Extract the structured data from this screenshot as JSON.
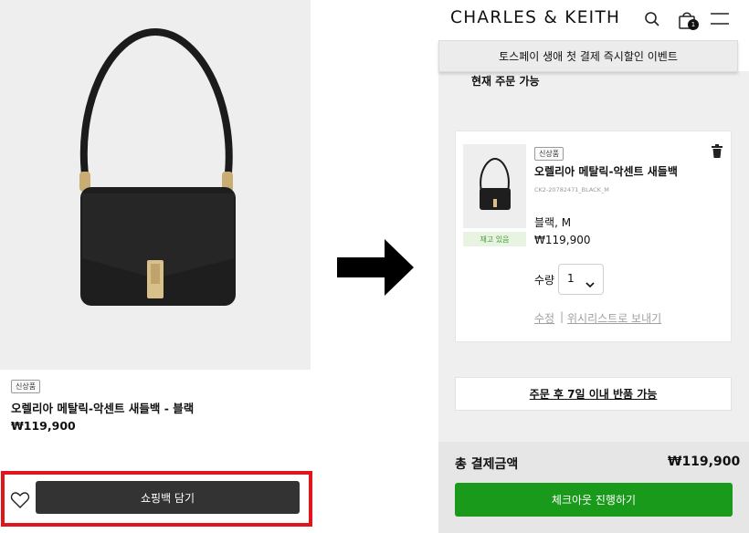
{
  "left": {
    "badge": "신상품",
    "title": "오렐리아 메탈릭-악센트 새들백 - 블랙",
    "price": "₩119,900",
    "add_to_bag_label": "쇼핑백 담기",
    "highlight_color": "#e1161c"
  },
  "header": {
    "brand": "CHARLES & KEITH",
    "bag_count": "1",
    "icons": [
      "search-icon",
      "bag-icon",
      "menu-icon"
    ]
  },
  "promo_banner": "토스페이 생애 첫 결제 즉시할인 이벤트",
  "cart": {
    "section_label": "현재 주문 가능",
    "item": {
      "badge": "신상품",
      "title": "오렐리아 메탈릭-악센트 새들백",
      "sku": "CK2-20782471_BLACK_M",
      "option": "블랙, M",
      "price": "₩119,900",
      "stock": "재고 있음",
      "quantity_label": "수량",
      "quantity_value": "1",
      "edit_label": "수정",
      "divider": "|",
      "wishlist_label": "위시리스트로 보내기"
    },
    "return_policy": "주문 후 7일 이내 반품 가능",
    "total_label": "총 결제금액",
    "total_value": "₩119,900",
    "checkout_label": "체크아웃 진행하기"
  },
  "colors": {
    "checkout_green": "#1a9a1a",
    "stock_green": "#3c9a2e",
    "button_dark": "#333333"
  }
}
